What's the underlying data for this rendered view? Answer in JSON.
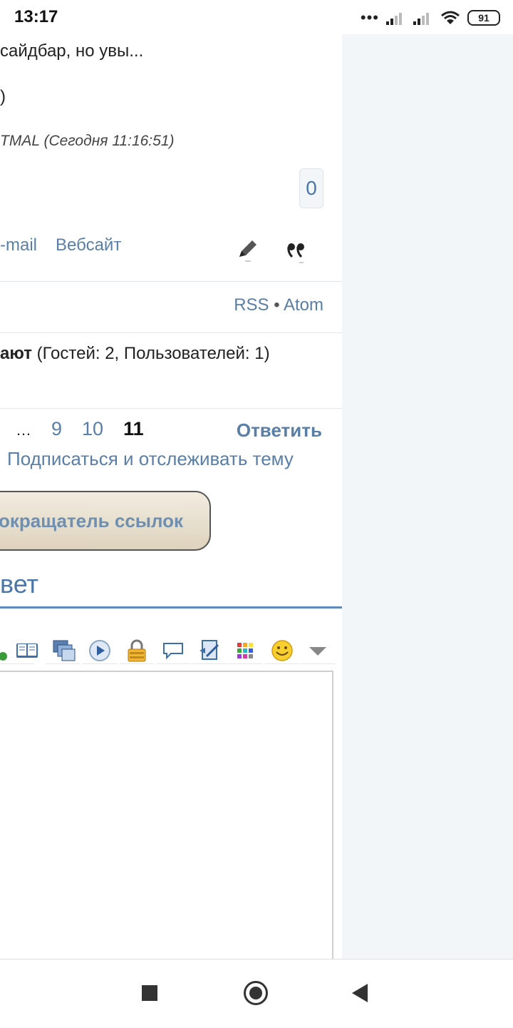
{
  "status_bar": {
    "time": "13:17",
    "battery": "91"
  },
  "post": {
    "text_line_1": "сайдбар, но увы...",
    "text_line_2": ")",
    "edited_note": "TMAL (Сегодня 11:16:51)",
    "like_count": "0",
    "email_link": "-mail",
    "website_link": "Вебсайт"
  },
  "feeds": {
    "rss": "RSS",
    "separator": " • ",
    "atom": "Atom"
  },
  "online": {
    "label": "ают",
    "detail": " (Гостей: 2, Пользователей: 1)"
  },
  "pagination": {
    "ellipsis": "…",
    "pages": [
      "9",
      "10"
    ],
    "current": "11",
    "reply": "Ответить",
    "subscribe": "Подписаться и отслеживать тему"
  },
  "shortener_button": "окращатель ссылок",
  "reply_form": {
    "title": "вет"
  },
  "toolbar_icons": [
    "book-icon",
    "windows-icon",
    "play-icon",
    "lock-icon",
    "speech-bubble-icon",
    "script-icon",
    "colors-grid-icon",
    "smiley-icon",
    "dropdown-arrow-icon"
  ],
  "colors": {
    "link": "#5a7fa6",
    "accent": "#4a76a8",
    "sidebar_bg": "#f3f6f9"
  }
}
